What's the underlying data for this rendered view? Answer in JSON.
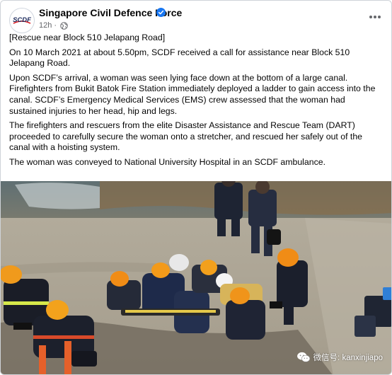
{
  "post": {
    "page_name": "Singapore Civil Defence Force",
    "avatar_logo_text": "SCDF",
    "timestamp": "12h",
    "separator": "·",
    "paragraphs": [
      "[Rescue near Block 510 Jelapang Road]",
      "On 10 March 2021 at about 5.50pm, SCDF received a call for assistance near Block 510 Jelapang Road.",
      "Upon SCDF’s arrival, a woman was seen lying face down at the bottom of a large canal. Firefighters from Bukit Batok Fire Station immediately deployed a ladder to gain access into the canal. SCDF’s Emergency Medical Services (EMS) crew assessed that the woman had sustained injuries to her head, hip and legs.",
      "The firefighters and rescuers from the elite Disaster Assistance and Rescue Team (DART) proceeded to carefully secure the woman onto a stretcher, and rescued her safely out of the canal with a hoisting system.",
      "The woman was conveyed to National University Hospital in an SCDF ambulance."
    ]
  },
  "photo": {
    "watermark_text": "微信号: kanxinjiapo"
  },
  "icons": {
    "verified": "verified-badge-icon",
    "privacy": "globe-icon",
    "menu": "more-options-icon",
    "wechat": "wechat-icon"
  },
  "colors": {
    "verified_blue": "#1877f2",
    "secondary_text": "#65676b",
    "scdf_red": "#d71920",
    "scdf_navy": "#1c2a5c"
  }
}
